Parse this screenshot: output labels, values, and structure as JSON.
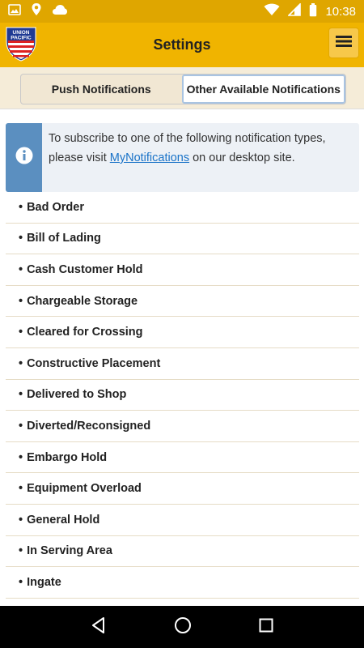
{
  "status_bar": {
    "time": "10:38"
  },
  "app_bar": {
    "title": "Settings"
  },
  "tabs": [
    {
      "label": "Push Notifications",
      "active": false
    },
    {
      "label": "Other Available Notifications",
      "active": true
    }
  ],
  "info": {
    "text_before": "To subscribe to one of the following notification types, please visit ",
    "link": "MyNotifications",
    "text_after": " on our desktop site."
  },
  "notifications": [
    "Bad Order",
    "Bill of Lading",
    "Cash Customer Hold",
    "Chargeable Storage",
    "Cleared for Crossing",
    "Constructive Placement",
    "Delivered to Shop",
    "Diverted/Reconsigned",
    "Embargo Hold",
    "Equipment Overload",
    "General Hold",
    "In Serving Area",
    "Ingate"
  ],
  "logo_text": [
    "UNION",
    "PACIFIC"
  ],
  "colors": {
    "status_bar": "#dfa600",
    "app_bar": "#f0b400",
    "info_accent": "#5b8fc0",
    "link": "#1a73c8"
  }
}
